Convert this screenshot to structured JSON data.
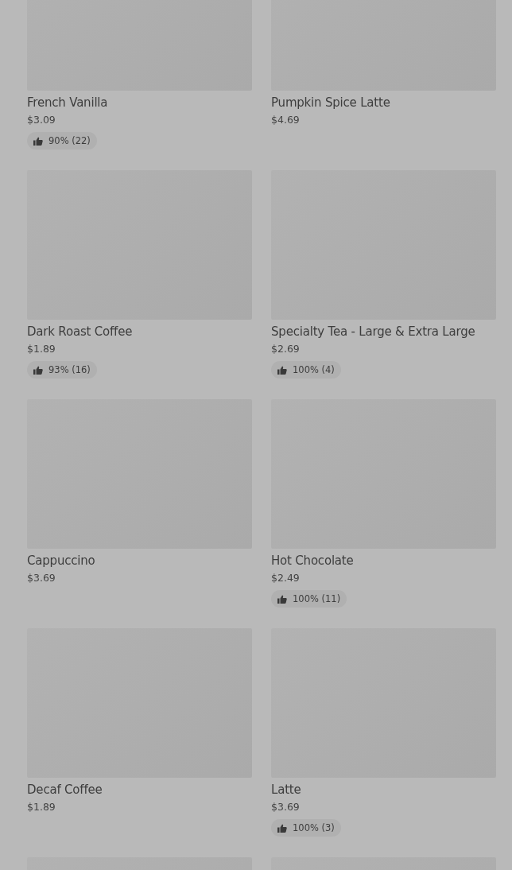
{
  "products": [
    {
      "kind": "product",
      "name": "French Vanilla",
      "price": "$3.09",
      "rating": "90% (22)"
    },
    {
      "kind": "product",
      "name": "Pumpkin Spice Latte",
      "price": "$4.69"
    },
    {
      "kind": "product",
      "name": "Dark Roast Coffee",
      "price": "$1.89",
      "rating": "93% (16)"
    },
    {
      "kind": "product",
      "name": "Specialty Tea - Large & Extra Large",
      "price": "$2.69",
      "rating": "100% (4)"
    },
    {
      "kind": "product",
      "name": "Cappuccino",
      "price": "$3.69"
    },
    {
      "kind": "product",
      "name": "Hot Chocolate",
      "price": "$2.49",
      "rating": "100% (11)"
    },
    {
      "kind": "product",
      "name": "Decaf Coffee",
      "price": "$1.89"
    },
    {
      "kind": "product",
      "name": "Latte",
      "price": "$3.69",
      "rating": "100% (3)"
    },
    {
      "kind": "placeholder"
    },
    {
      "kind": "placeholder"
    }
  ]
}
